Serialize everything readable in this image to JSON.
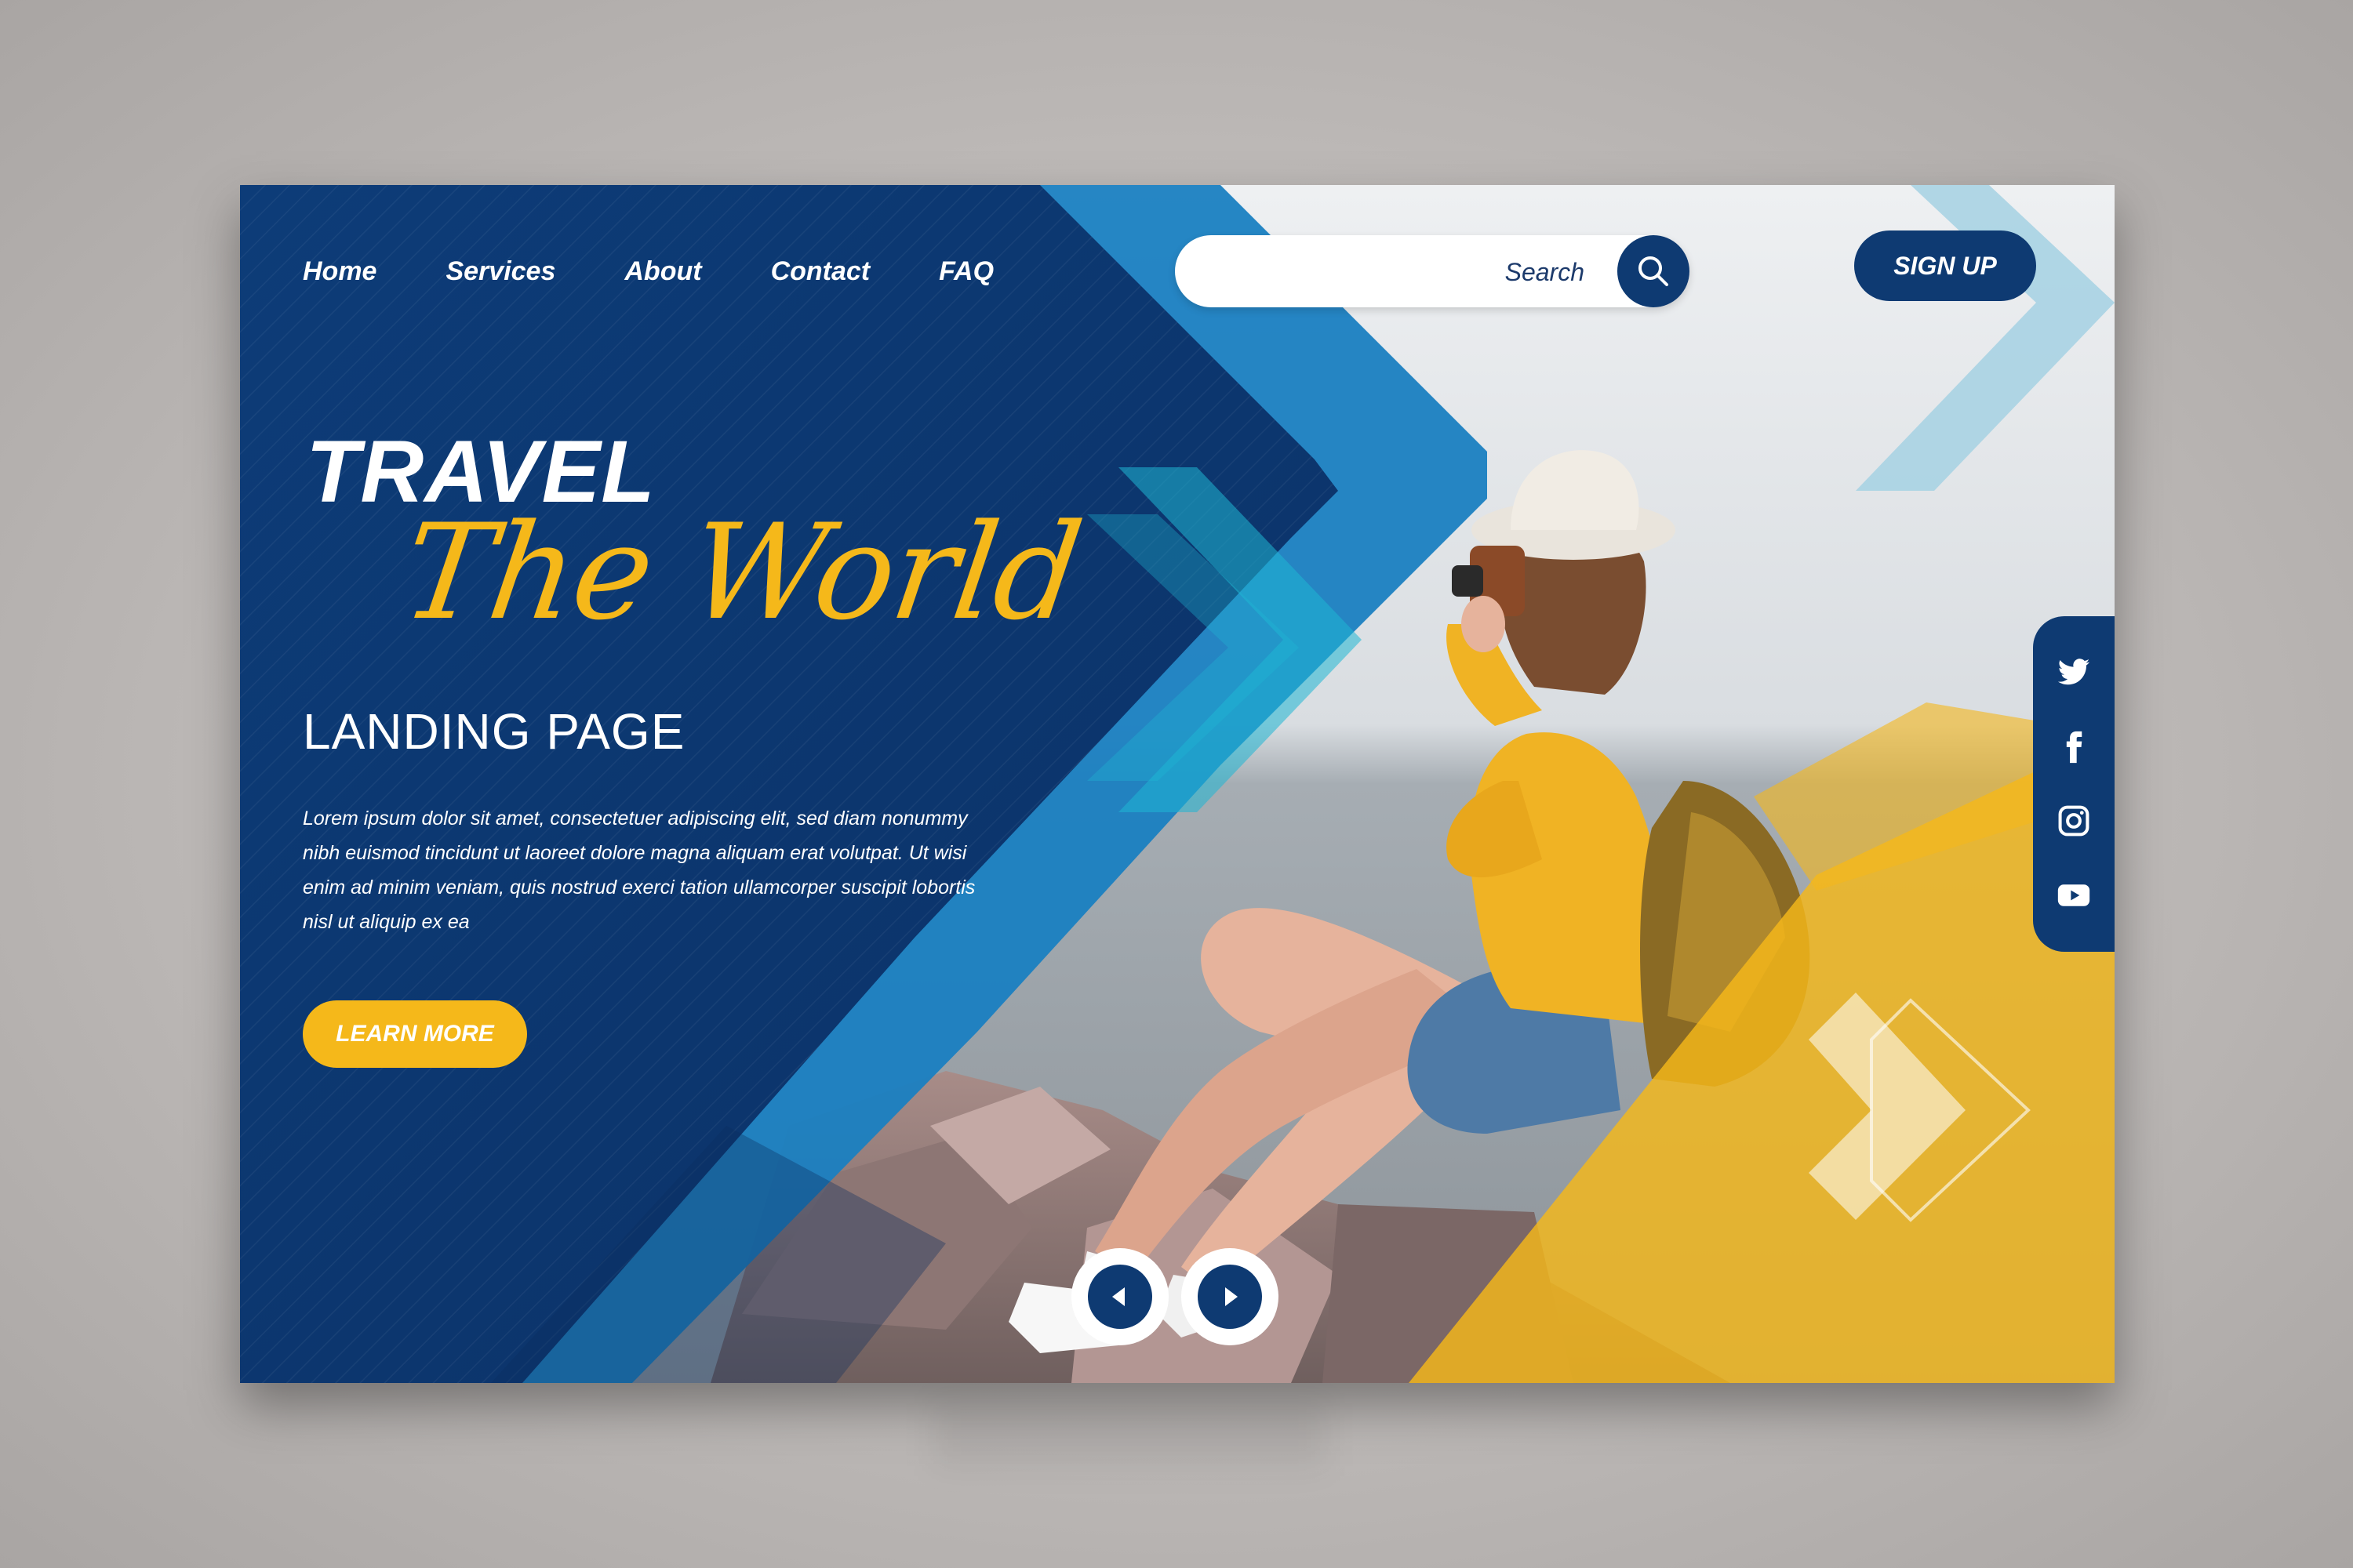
{
  "nav": {
    "items": [
      {
        "label": "Home"
      },
      {
        "label": "Services"
      },
      {
        "label": "About"
      },
      {
        "label": "Contact"
      },
      {
        "label": "FAQ"
      }
    ]
  },
  "search": {
    "placeholder": "Search",
    "icon": "search-icon"
  },
  "signup": {
    "label": "SIGN UP"
  },
  "hero": {
    "title": "TRAVEL",
    "script": "The World",
    "subtitle": "LANDING PAGE",
    "body": "Lorem ipsum dolor sit amet, consectetuer adipiscing elit, sed diam nonummy nibh euismod tincidunt ut laoreet dolore magna aliquam erat volutpat. Ut wisi enim ad minim veniam, quis nostrud exerci tation ullamcorper suscipit lobortis nisl ut aliquip ex ea",
    "cta": "LEARN MORE"
  },
  "social": [
    "twitter-icon",
    "facebook-icon",
    "instagram-icon",
    "youtube-icon"
  ],
  "slider": {
    "prev_icon": "chevron-left-icon",
    "next_icon": "chevron-right-icon"
  },
  "colors": {
    "navy": "#0e3a72",
    "blue": "#1565a8",
    "cyan": "#1fb6d4",
    "yellow": "#f5b81a",
    "light_blue": "#a9d3e3"
  }
}
